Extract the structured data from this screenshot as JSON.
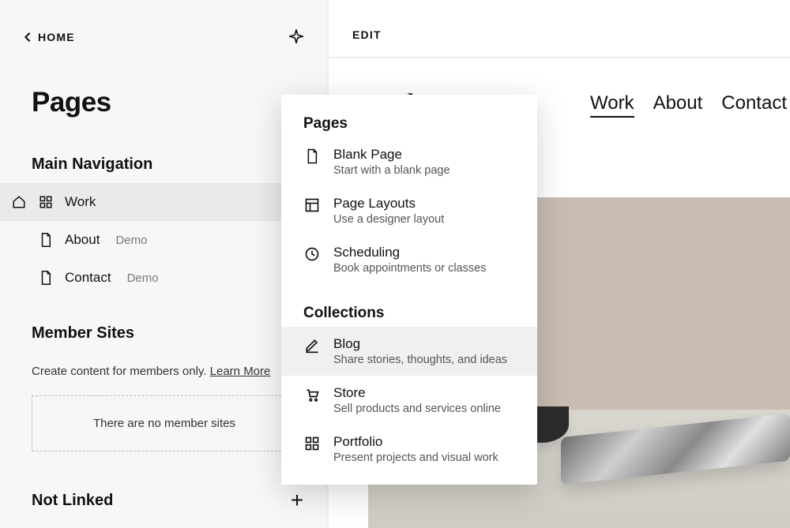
{
  "sidebar": {
    "home_label": "HOME",
    "title": "Pages",
    "sections": {
      "main_nav": {
        "title": "Main Navigation",
        "items": [
          {
            "label": "Work",
            "demo": "",
            "active": true,
            "is_home": true
          },
          {
            "label": "About",
            "demo": "Demo",
            "active": false,
            "is_home": false
          },
          {
            "label": "Contact",
            "demo": "Demo",
            "active": false,
            "is_home": false
          }
        ]
      },
      "member_sites": {
        "title": "Member Sites",
        "desc": "Create content for members only.",
        "learn_more": "Learn More",
        "empty_text": "There are no member sites"
      },
      "not_linked": {
        "title": "Not Linked"
      }
    }
  },
  "preview": {
    "edit_label": "EDIT",
    "site_title_visible": "raphy",
    "nav": [
      {
        "label": "Work",
        "active": true
      },
      {
        "label": "About",
        "active": false
      },
      {
        "label": "Contact",
        "active": false
      }
    ]
  },
  "popover": {
    "section_pages": {
      "title": "Pages",
      "items": [
        {
          "id": "blank",
          "title": "Blank Page",
          "sub": "Start with a blank page"
        },
        {
          "id": "layouts",
          "title": "Page Layouts",
          "sub": "Use a designer layout"
        },
        {
          "id": "scheduling",
          "title": "Scheduling",
          "sub": "Book appointments or classes"
        }
      ]
    },
    "section_collections": {
      "title": "Collections",
      "items": [
        {
          "id": "blog",
          "title": "Blog",
          "sub": "Share stories, thoughts, and ideas",
          "hover": true
        },
        {
          "id": "store",
          "title": "Store",
          "sub": "Sell products and services online"
        },
        {
          "id": "portfolio",
          "title": "Portfolio",
          "sub": "Present projects and visual work"
        }
      ]
    }
  }
}
